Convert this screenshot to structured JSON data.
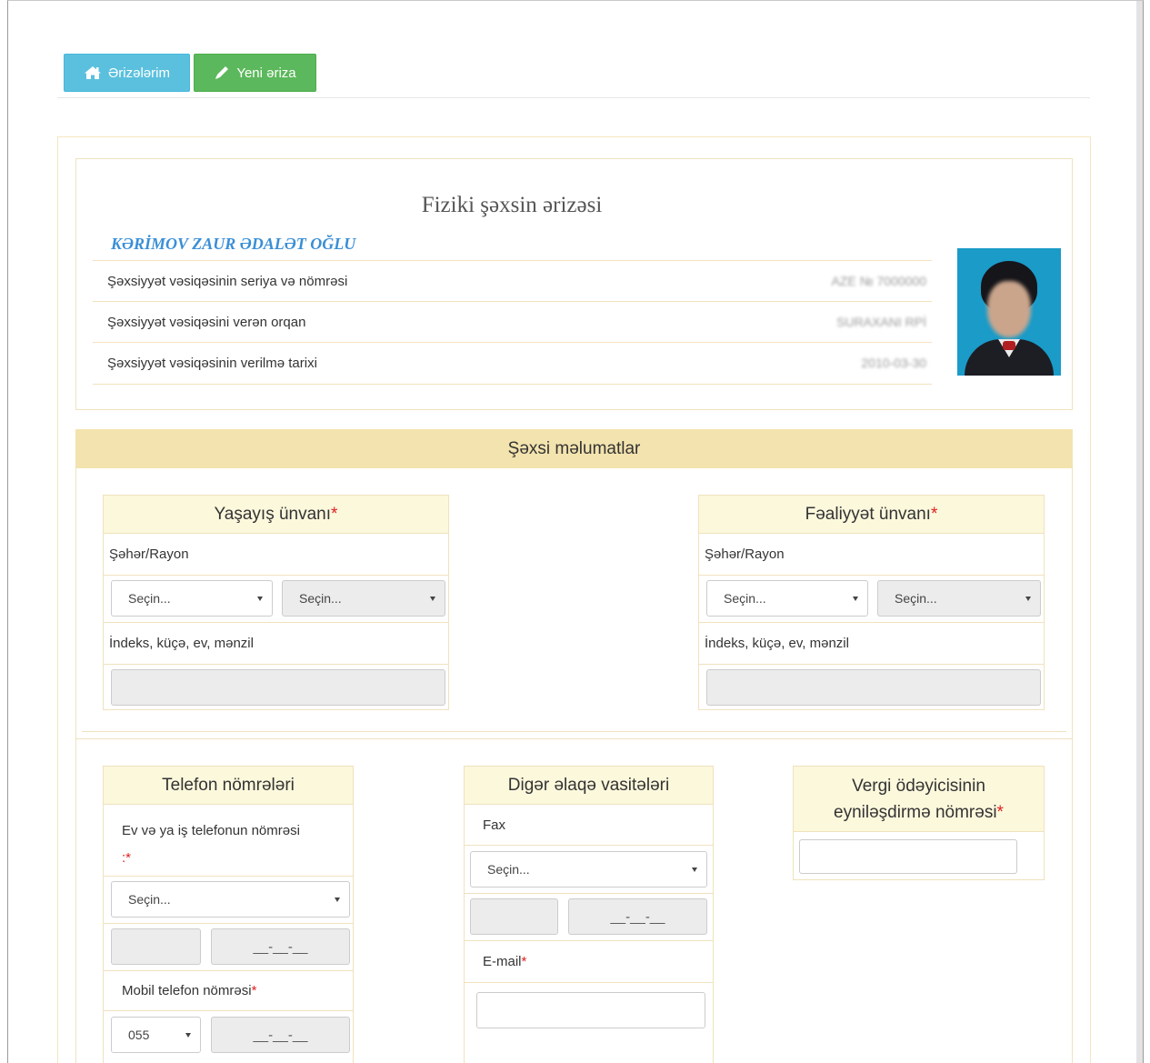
{
  "toolbar": {
    "my_applications_label": "Ərizələrim",
    "new_application_label": "Yeni əriza"
  },
  "application": {
    "title": "Fiziki şəxsin ərizəsi",
    "person_name": "KƏRİMOV ZAUR ƏDALƏT OĞLU",
    "rows": [
      {
        "label": "Şəxsiyyət vəsiqəsinin seriya və nömrəsi",
        "value": "AZE № 7000000"
      },
      {
        "label": "Şəxsiyyət vəsiqəsini verən orqan",
        "value": "SURAXANI RPİ"
      },
      {
        "label": "Şəxsiyyət vəsiqəsinin verilmə tarixi",
        "value": "2010-03-30"
      }
    ]
  },
  "personal": {
    "section_title": "Şəxsi məlumatlar",
    "residence": {
      "title": "Yaşayış ünvanı",
      "required_mark": "*",
      "city_label": "Şəhər/Rayon",
      "select1": "Seçin...",
      "select2": "Seçin...",
      "address_label": "İndeks, küçə, ev, mənzil",
      "address_value": ""
    },
    "activity": {
      "title": "Fəaliyyət ünvanı",
      "required_mark": "*",
      "city_label": "Şəhər/Rayon",
      "select1": "Seçin...",
      "select2": "Seçin...",
      "address_label": "İndeks, küçə, ev, mənzil",
      "address_value": ""
    }
  },
  "phones": {
    "title": "Telefon nömrələri",
    "home_label": "Ev və ya iş telefonun nömrəsi",
    "home_required": ":*",
    "home_select": "Seçin...",
    "home_mask": "__-__-__",
    "mobile_label": "Mobil telefon nömrəsi",
    "mobile_required": "*",
    "mobile_prefix": "055",
    "mobile_mask": "__-__-__"
  },
  "other_contacts": {
    "title": "Digər əlaqə vasitələri",
    "fax_label": "Fax",
    "fax_select": "Seçin...",
    "fax_mask": "__-__-__",
    "email_label": "E-mail",
    "email_required": "*",
    "email_value": ""
  },
  "tax": {
    "title_line1": "Vergi ödəyicisinin",
    "title_line2": "eyniləşdirmə nömrəsi",
    "required_mark": "*",
    "value": ""
  },
  "colors": {
    "info_button": "#5bc0de",
    "success_button": "#5cb85c",
    "section_header": "#f3e3ae",
    "box_header": "#fcf8dc",
    "name_link": "#3a8fd6",
    "required": "#e02020"
  }
}
